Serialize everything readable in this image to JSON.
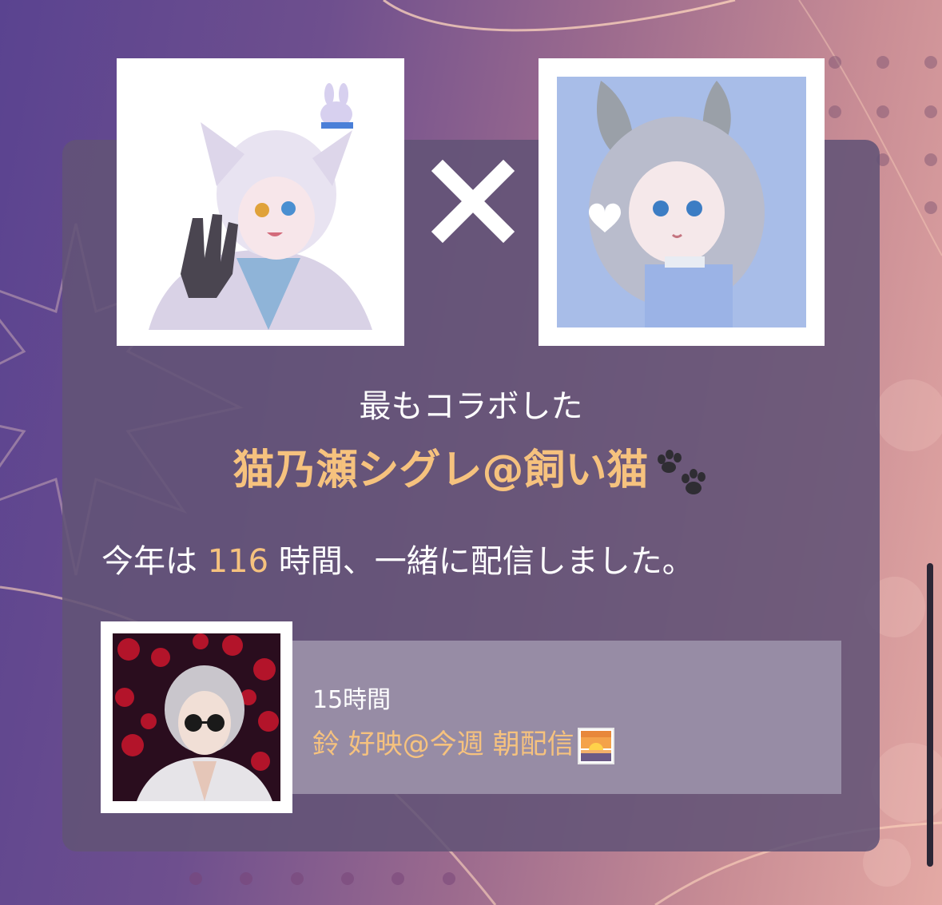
{
  "collab": {
    "label": "最もコラボした",
    "partner_name": "猫乃瀬シグレ@飼い猫",
    "partner_emoji": "paw-prints-icon",
    "hours_prefix": "今年は ",
    "hours_value": "116",
    "hours_suffix": " 時間、一緒に配信しました。"
  },
  "runner_up": {
    "hours": "15時間",
    "name": "鈴 好映@今週 朝配信",
    "emoji": "sunrise-icon"
  },
  "icons": {
    "cross": "close-x-icon"
  },
  "colors": {
    "accent": "#f6c27e",
    "card": "#625376",
    "runner_bar": "#978ca5",
    "text": "#ffffff"
  }
}
